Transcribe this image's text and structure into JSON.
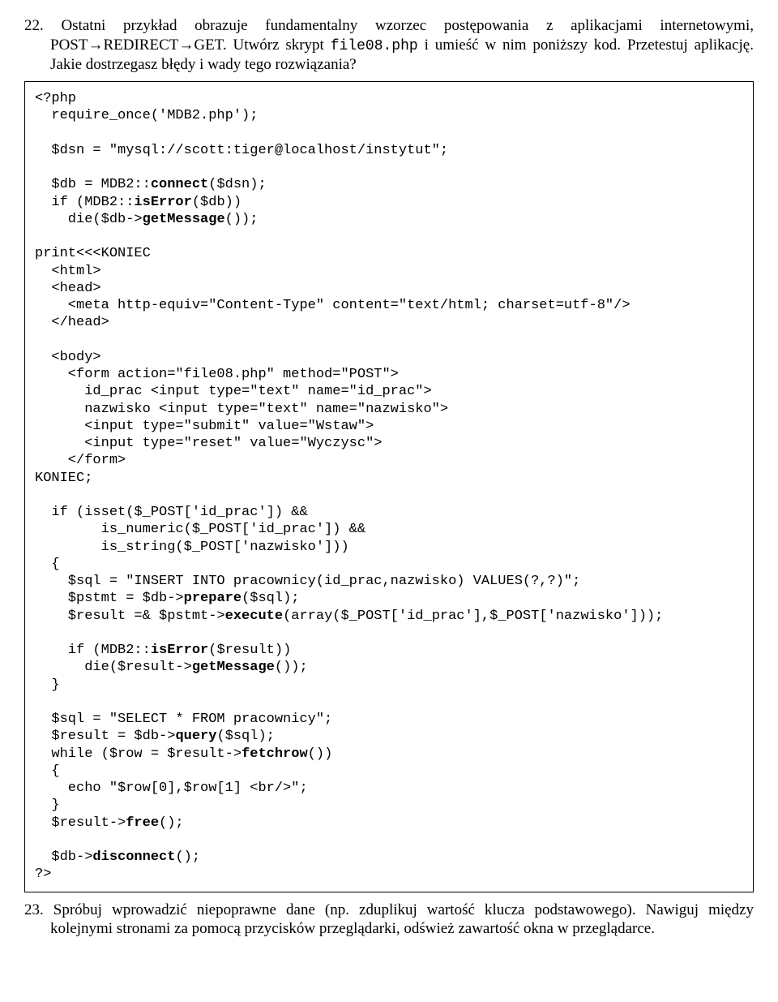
{
  "q22": {
    "num": "22. ",
    "text_before_file": "Ostatni przykład obrazuje fundamentalny wzorzec postępowania z aplikacjami internetowymi, POST→REDIRECT→GET. Utwórz skrypt ",
    "filename": "file08.php",
    "text_after_file": " i umieść w nim poniższy kod. Przetestuj aplikację. Jakie dostrzegasz błędy i wady tego rozwiązania?"
  },
  "code": {
    "l01": "<?php",
    "l02": "  require_once('MDB2.php');",
    "l03": "",
    "l04": "  $dsn = \"mysql://scott:tiger@localhost/instytut\";",
    "l05": "",
    "l06a": "  $db = MDB2::",
    "l06b": "connect",
    "l06c": "($dsn);",
    "l07a": "  if (MDB2::",
    "l07b": "isError",
    "l07c": "($db))",
    "l08a": "    die($db->",
    "l08b": "getMessage",
    "l08c": "());",
    "l09": "",
    "l10": "print<<<KONIEC",
    "l11": "  <html>",
    "l12": "  <head>",
    "l13": "    <meta http-equiv=\"Content-Type\" content=\"text/html; charset=utf-8\"/>",
    "l14": "  </head>",
    "l15": "",
    "l16": "  <body>",
    "l17": "    <form action=\"file08.php\" method=\"POST\">",
    "l18": "      id_prac <input type=\"text\" name=\"id_prac\">",
    "l19": "      nazwisko <input type=\"text\" name=\"nazwisko\">",
    "l20": "      <input type=\"submit\" value=\"Wstaw\">",
    "l21": "      <input type=\"reset\" value=\"Wyczysc\">",
    "l22": "    </form>",
    "l23": "KONIEC;",
    "l24": "",
    "l25": "  if (isset($_POST['id_prac']) &&",
    "l26": "        is_numeric($_POST['id_prac']) &&",
    "l27": "        is_string($_POST['nazwisko']))",
    "l28": "  {",
    "l29": "    $sql = \"INSERT INTO pracownicy(id_prac,nazwisko) VALUES(?,?)\";",
    "l30a": "    $pstmt = $db->",
    "l30b": "prepare",
    "l30c": "($sql);",
    "l31a": "    $result =& $pstmt->",
    "l31b": "execute",
    "l31c": "(array($_POST['id_prac'],$_POST['nazwisko']));",
    "l32": "",
    "l33a": "    if (MDB2::",
    "l33b": "isError",
    "l33c": "($result))",
    "l34a": "      die($result->",
    "l34b": "getMessage",
    "l34c": "());",
    "l35": "  }",
    "l36": "",
    "l37": "  $sql = \"SELECT * FROM pracownicy\";",
    "l38a": "  $result = $db->",
    "l38b": "query",
    "l38c": "($sql);",
    "l39a": "  while ($row = $result->",
    "l39b": "fetchrow",
    "l39c": "())",
    "l40": "  {",
    "l41": "    echo \"$row[0],$row[1] <br/>\";",
    "l42": "  }",
    "l43a": "  $result->",
    "l43b": "free",
    "l43c": "();",
    "l44": "",
    "l45a": "  $db->",
    "l45b": "disconnect",
    "l45c": "();",
    "l46": "?>"
  },
  "q23": {
    "num": "23. ",
    "text": "Spróbuj wprowadzić niepoprawne dane (np. zduplikuj wartość klucza podstawowego). Nawiguj między kolejnymi stronami za pomocą przycisków przeglądarki, odśwież zawartość okna w przeglądarce."
  }
}
